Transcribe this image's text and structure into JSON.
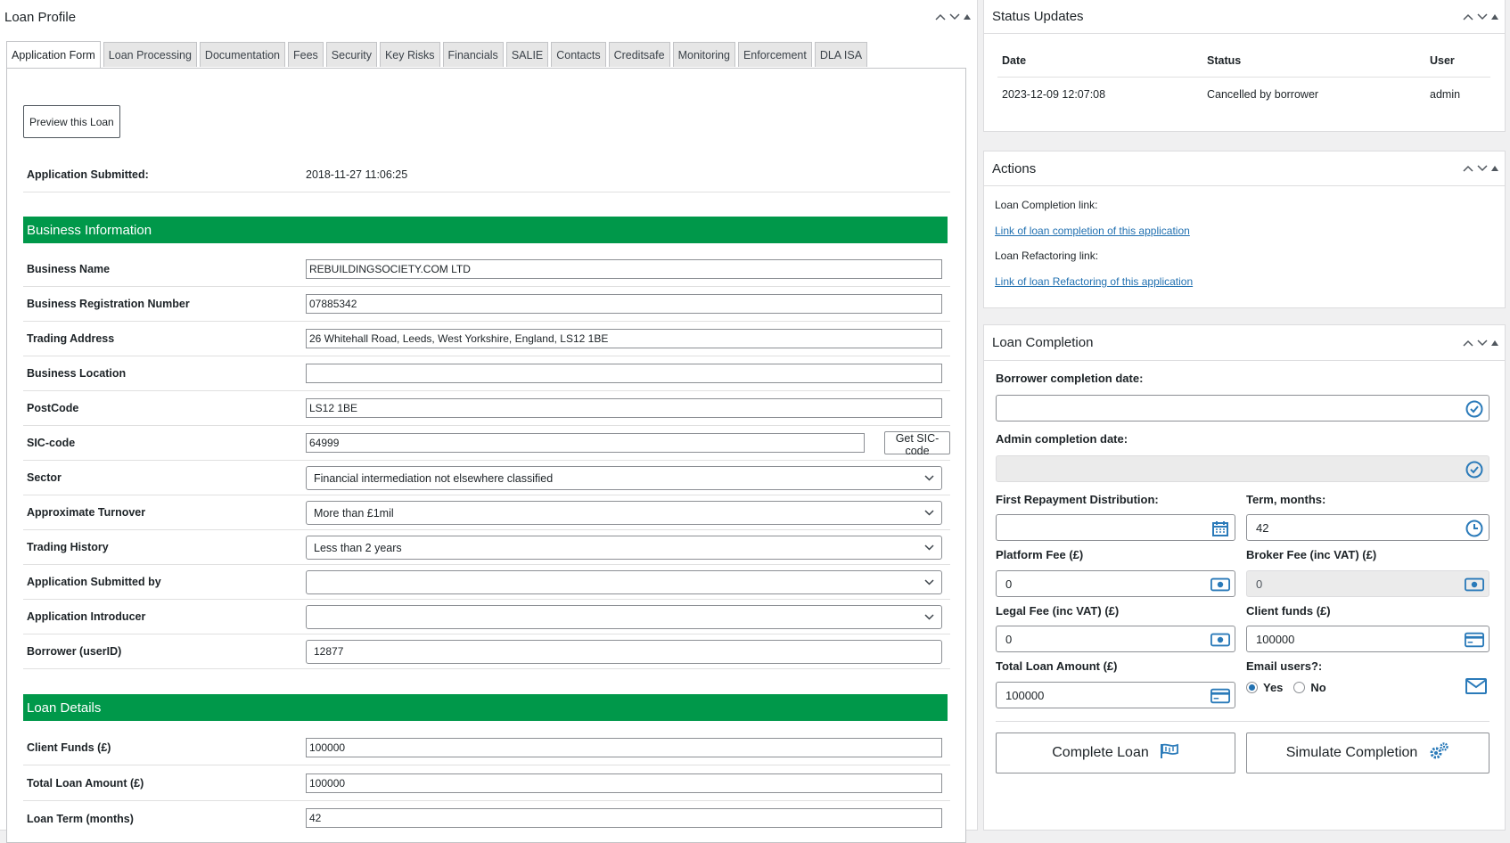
{
  "loan_profile": {
    "title": "Loan Profile",
    "tabs": [
      {
        "label": "Application Form",
        "active": true
      },
      {
        "label": "Loan Processing"
      },
      {
        "label": "Documentation"
      },
      {
        "label": "Fees"
      },
      {
        "label": "Security"
      },
      {
        "label": "Key Risks"
      },
      {
        "label": "Financials"
      },
      {
        "label": "SALIE"
      },
      {
        "label": "Contacts"
      },
      {
        "label": "Creditsafe"
      },
      {
        "label": "Monitoring"
      },
      {
        "label": "Enforcement"
      },
      {
        "label": "DLA ISA"
      }
    ],
    "preview_label": "Preview this Loan",
    "submitted_label": "Application Submitted:",
    "submitted_value": "2018-11-27 11:06:25",
    "business_section": "Business Information",
    "fields": {
      "business_name": {
        "label": "Business Name",
        "value": "REBUILDINGSOCIETY.COM  LTD"
      },
      "reg_number": {
        "label": "Business Registration Number",
        "value": "07885342"
      },
      "trading_address": {
        "label": "Trading Address",
        "value": "26  Whitehall Road, Leeds, West Yorkshire, England, LS12 1BE"
      },
      "business_location": {
        "label": "Business Location",
        "value": ""
      },
      "postcode": {
        "label": "PostCode",
        "value": "LS12 1BE"
      },
      "sic_code": {
        "label": "SIC-code",
        "value": "64999",
        "button": "Get SIC-code"
      },
      "sector": {
        "label": "Sector",
        "value": "Financial intermediation not elsewhere classified"
      },
      "turnover": {
        "label": "Approximate Turnover",
        "value": "More than £1mil"
      },
      "trading_history": {
        "label": "Trading History",
        "value": "Less than 2 years"
      },
      "submitted_by": {
        "label": "Application Submitted by",
        "value": ""
      },
      "introducer": {
        "label": "Application Introducer",
        "value": ""
      },
      "borrower": {
        "label": "Borrower (userID)",
        "value": "12877"
      }
    },
    "loan_section": "Loan Details",
    "loan_fields": {
      "client_funds": {
        "label": "Client Funds (£)",
        "value": "100000"
      },
      "total_loan": {
        "label": "Total Loan Amount (£)",
        "value": "100000"
      },
      "loan_term": {
        "label": "Loan Term (months)",
        "value": "42"
      }
    }
  },
  "status_updates": {
    "title": "Status Updates",
    "headers": [
      "Date",
      "Status",
      "User"
    ],
    "rows": [
      {
        "date": "2023-12-09 12:07:08",
        "status": "Cancelled by borrower",
        "user": "admin"
      }
    ]
  },
  "actions": {
    "title": "Actions",
    "completion_label": "Loan Completion link:",
    "completion_link": "Link of loan completion of this application",
    "refactoring_label": "Loan Refactoring link:",
    "refactoring_link": "Link of loan Refactoring of this application"
  },
  "loan_completion": {
    "title": "Loan Completion",
    "borrower_date_label": "Borrower completion date:",
    "borrower_date_value": "",
    "admin_date_label": "Admin completion date:",
    "admin_date_value": "",
    "first_repayment_label": "First Repayment Distribution:",
    "first_repayment_value": "",
    "term_label": "Term, months:",
    "term_value": "42",
    "platform_fee_label": "Platform Fee (£)",
    "platform_fee_value": "0",
    "broker_fee_label": "Broker Fee (inc VAT) (£)",
    "broker_fee_value": "0",
    "legal_fee_label": "Legal Fee (inc VAT) (£)",
    "legal_fee_value": "0",
    "client_funds_label": "Client funds (£)",
    "client_funds_value": "100000",
    "total_loan_label": "Total Loan Amount (£)",
    "total_loan_value": "100000",
    "email_label": "Email users?:",
    "email_yes": "Yes",
    "email_no": "No",
    "email_selected": "Yes",
    "complete_button": "Complete Loan",
    "simulate_button": "Simulate Completion"
  },
  "colors": {
    "section_green": "#00984a",
    "link_blue": "#2271b1",
    "icon_blue": "#2a7ab9"
  }
}
